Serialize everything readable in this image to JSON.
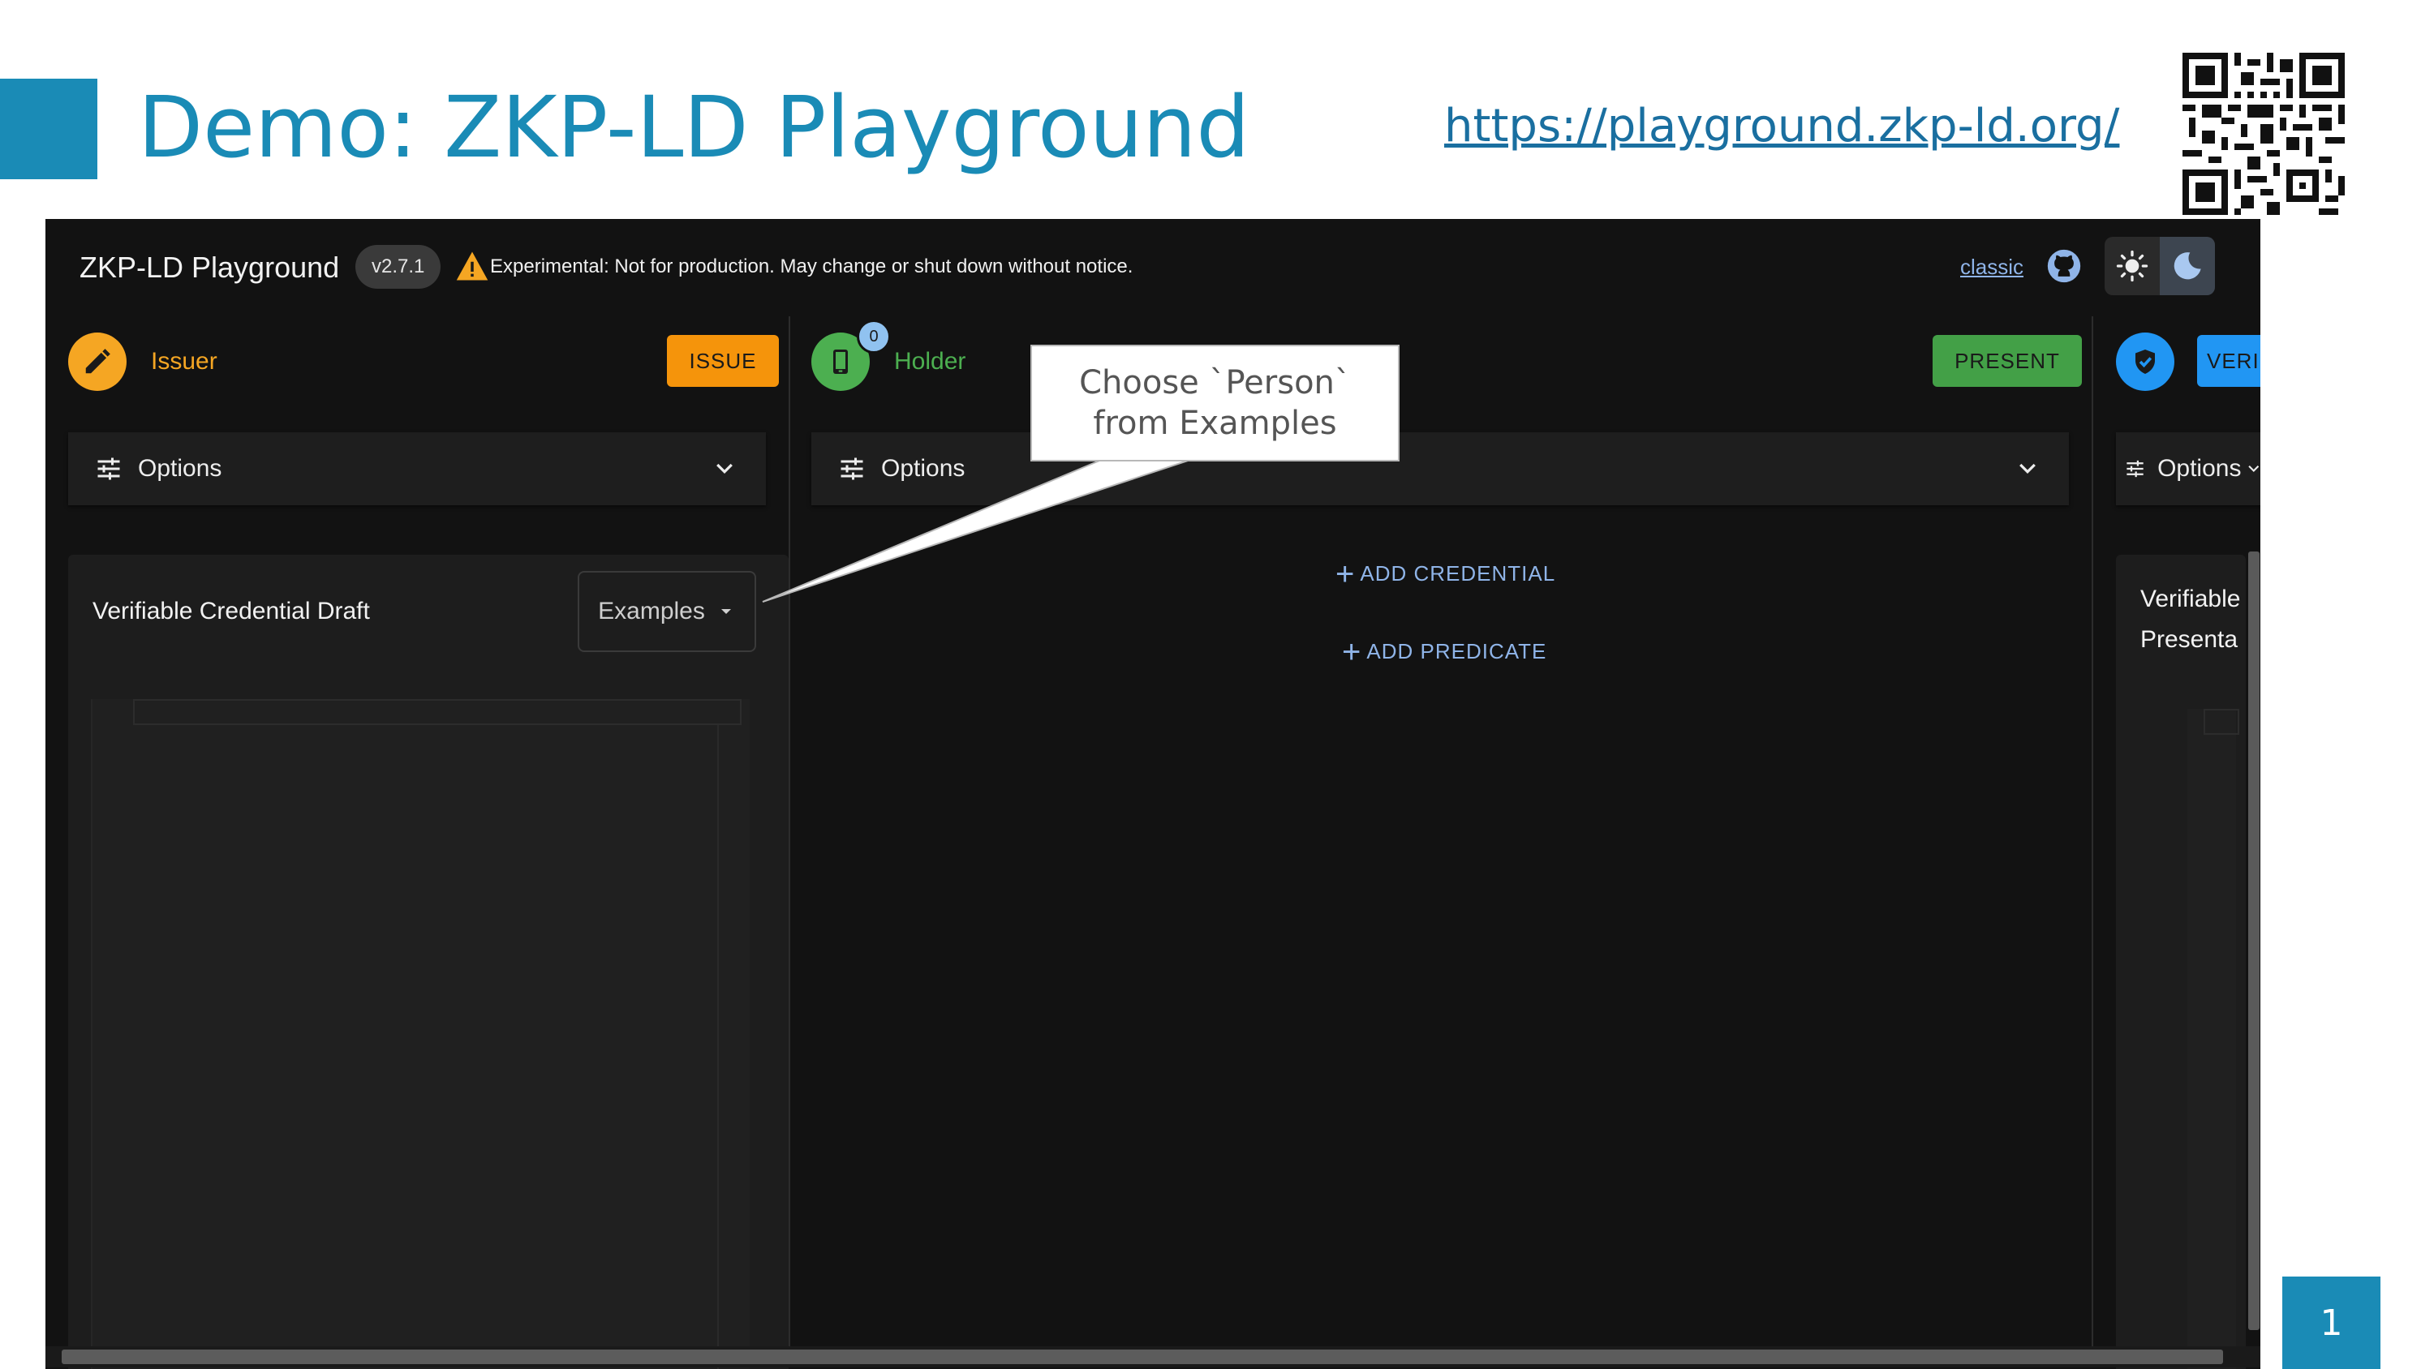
{
  "slide": {
    "title": "Demo: ZKP-LD Playground",
    "url": "https://playground.zkp-ld.org/",
    "page_number": "1",
    "colors": {
      "accent": "#1a8bb6"
    }
  },
  "app": {
    "title": "ZKP-LD Playground",
    "version": "v2.7.1",
    "warning": "Experimental: Not for production. May change or shut down without notice.",
    "classic_link": "classic",
    "issuer": {
      "label": "Issuer",
      "action": "ISSUE",
      "color": "#f5a623",
      "options_label": "Options",
      "card_title": "Verifiable Credential Draft",
      "examples_label": "Examples"
    },
    "holder": {
      "label": "Holder",
      "badge_count": "0",
      "action": "PRESENT",
      "color": "#4caf50",
      "options_label": "Options",
      "add_credential": "ADD CREDENTIAL",
      "add_predicate": "ADD PREDICATE"
    },
    "verifier": {
      "action": "VERIFY",
      "color": "#2196f3",
      "options_label": "Options",
      "card_title_line1": "Verifiable",
      "card_title_line2": "Presenta"
    }
  },
  "callout": {
    "line1": "Choose `Person`",
    "line2": "from Examples"
  }
}
